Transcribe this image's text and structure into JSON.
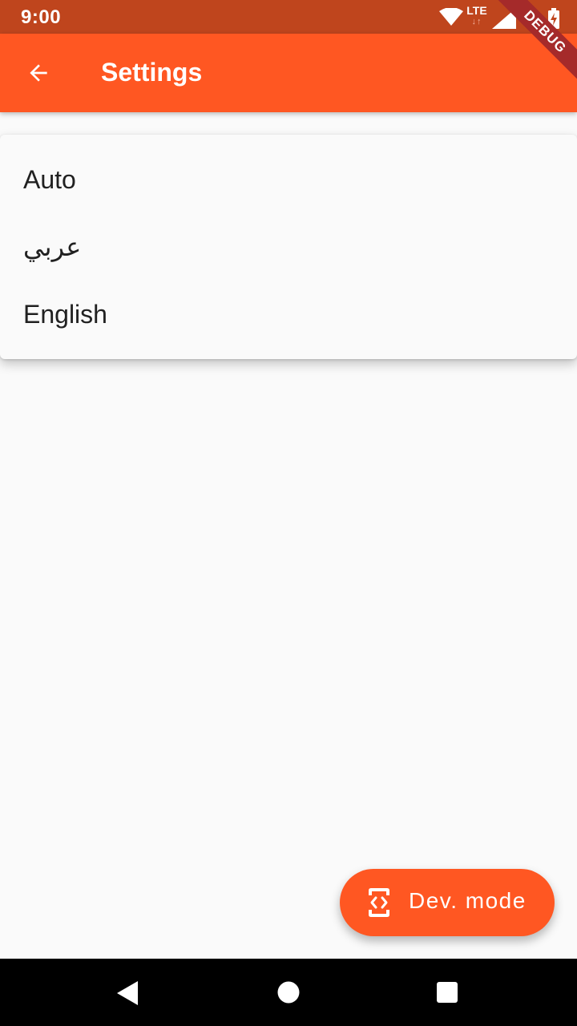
{
  "status_bar": {
    "time": "9:00",
    "network": "LTE",
    "network_arrows": "↓↑",
    "icons": [
      "wifi-icon",
      "lte-icon",
      "signal-icon",
      "battery-icon"
    ]
  },
  "debug_banner": {
    "text": "DEBUG"
  },
  "app_bar": {
    "title": "Settings",
    "back_icon": "arrow-left",
    "color": "#ff5722",
    "status_color": "#bf451d"
  },
  "language_menu": {
    "items": [
      {
        "label": "Auto"
      },
      {
        "label": "عربي"
      },
      {
        "label": "English"
      }
    ]
  },
  "fab": {
    "label": "Dev. mode",
    "icon": "developer-mode-icon",
    "color": "#ff5722"
  },
  "nav_bar": {
    "buttons": [
      "back-triangle",
      "home-circle",
      "recents-square"
    ]
  }
}
